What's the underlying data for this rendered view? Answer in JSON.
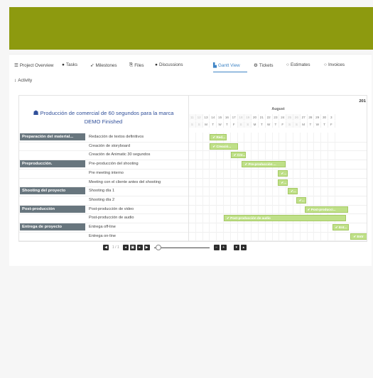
{
  "tabs": [
    {
      "label": "Project Overview",
      "icon": "list-icon",
      "glyph": "☰"
    },
    {
      "label": "Tasks",
      "icon": "check-circle-icon",
      "glyph": "●"
    },
    {
      "label": "Milestones",
      "icon": "rocket-icon",
      "glyph": "➶"
    },
    {
      "label": "Files",
      "icon": "files-icon",
      "glyph": "⎘"
    },
    {
      "label": "Discussions",
      "icon": "chat-icon",
      "glyph": "●"
    },
    {
      "label": "Gantt View",
      "icon": "gantt-icon",
      "glyph": "▙"
    },
    {
      "label": "Tickets",
      "icon": "ticket-icon",
      "glyph": "⚙"
    },
    {
      "label": "Estimates",
      "icon": "estimates-icon",
      "glyph": "○"
    },
    {
      "label": "Invoices",
      "icon": "invoices-icon",
      "glyph": "○"
    },
    {
      "label": "Activity",
      "icon": "activity-icon",
      "glyph": "↕"
    }
  ],
  "active_tab": "Gantt View",
  "colors": {
    "banner": "#8d9a0f",
    "accent": "#3e84c5",
    "group": "#68767e",
    "bar": "#bfe088"
  },
  "gantt": {
    "project_title_line1": "Producción de comercial de 60 segundos para la marca",
    "project_title_line2": "DEMO Finished",
    "project_icon": "sitemap-icon",
    "year": "201",
    "month": "August",
    "days": [
      "11",
      "12",
      "13",
      "14",
      "15",
      "16",
      "17",
      "18",
      "19",
      "20",
      "21",
      "22",
      "23",
      "24",
      "25",
      "26",
      "27",
      "28",
      "29",
      "30",
      "3"
    ],
    "weekdays": [
      "S",
      "S",
      "M",
      "T",
      "W",
      "T",
      "F",
      "S",
      "S",
      "M",
      "T",
      "W",
      "T",
      "F",
      "S",
      "S",
      "M",
      "T",
      "W",
      "T",
      "F"
    ],
    "rows": [
      {
        "group": "Preparación del material...",
        "task": "Redacción de textos definitivos",
        "bar": "✔ Red..."
      },
      {
        "group": "",
        "task": "Creación de storyboard",
        "bar": "✔ Creació..."
      },
      {
        "group": "",
        "task": "Creación de Animatic 30 segundos",
        "bar": "✔ Cre..."
      },
      {
        "group": "Preproducción.",
        "task": "Pre-producción del shooting",
        "bar": "✔ Pre-producción ..."
      },
      {
        "group": "",
        "task": "Pre meeting interno",
        "bar": "✔..."
      },
      {
        "group": "",
        "task": "Meeting con el cliente antes del shooting",
        "bar": "✔..."
      },
      {
        "group": "Shooting del proyecto",
        "task": "Shooting día 1",
        "bar": "✔..."
      },
      {
        "group": "",
        "task": "Shooting día 2",
        "bar": "✔..."
      },
      {
        "group": "Post-producción",
        "task": "Post-producción de video",
        "bar": "✔ Post-producci..."
      },
      {
        "group": "",
        "task": "Post-producción de audio",
        "bar": "✔ Post-producción de audio"
      },
      {
        "group": "Entrega de proyecto",
        "task": "Entrega off-line",
        "bar": "✔ Ent..."
      },
      {
        "group": "",
        "task": "Entrega on-line",
        "bar": "✔ Entr"
      }
    ]
  },
  "controls": {
    "pager": "1 / 1"
  }
}
